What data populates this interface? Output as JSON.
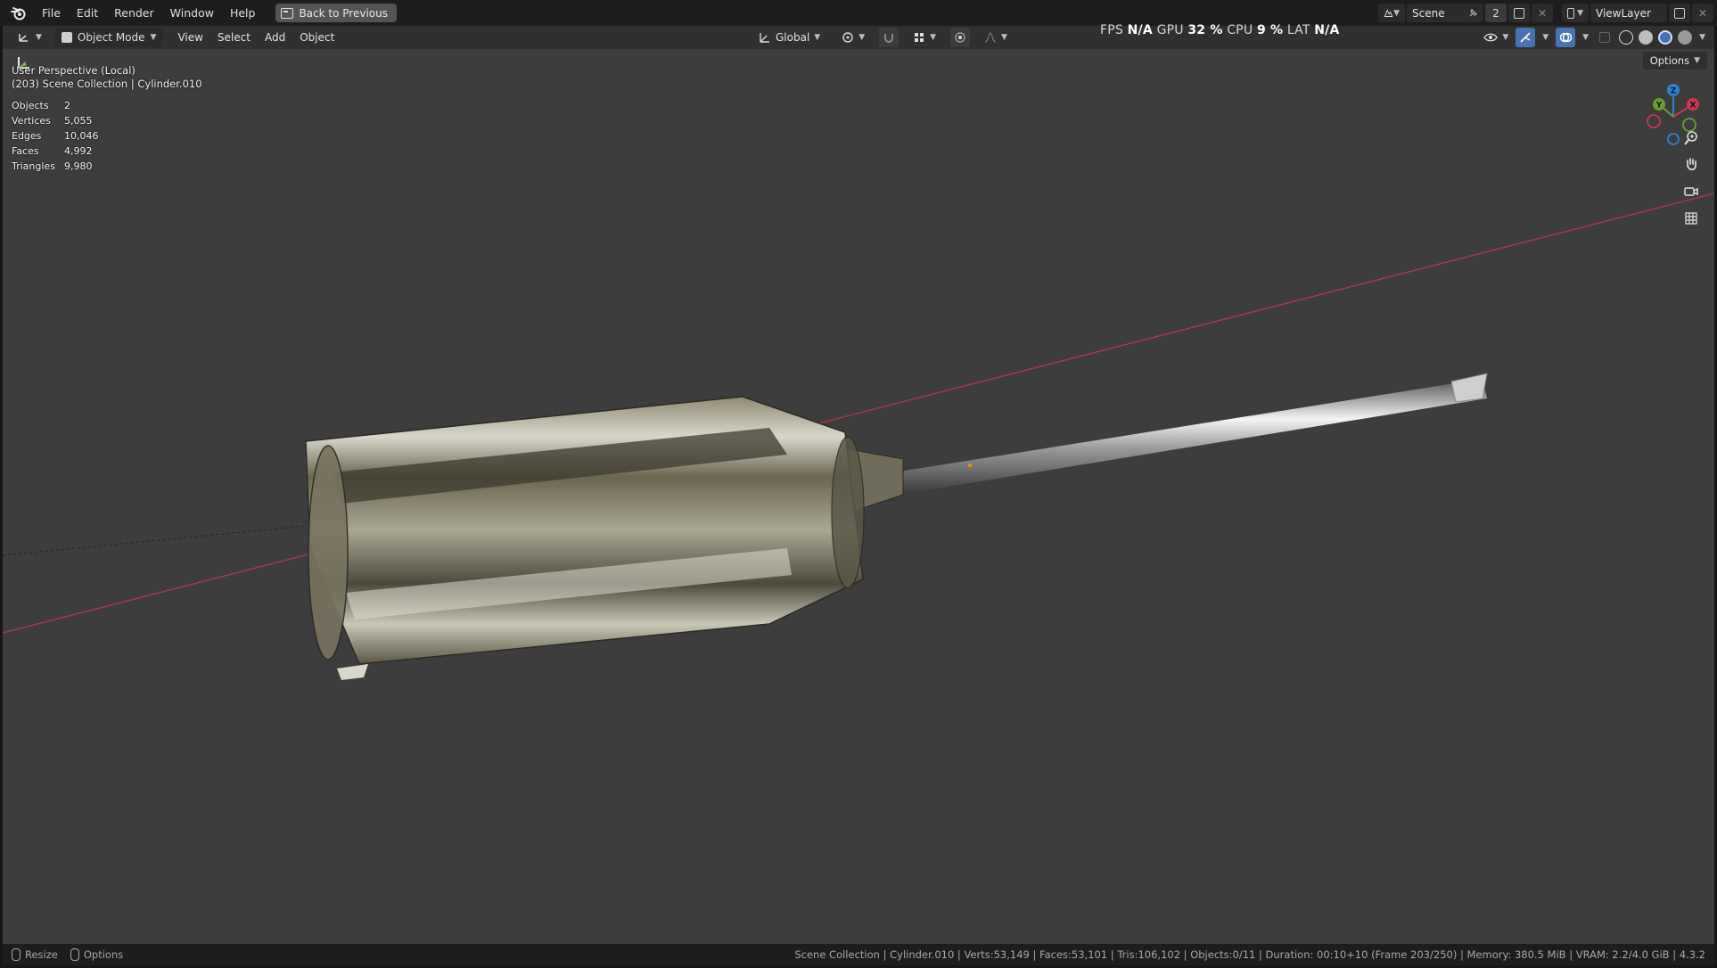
{
  "menu": {
    "items": [
      "File",
      "Edit",
      "Render",
      "Window",
      "Help"
    ],
    "back_label": "Back to Previous"
  },
  "top_right": {
    "scene_name": "Scene",
    "scene_users": "2",
    "view_layer": "ViewLayer"
  },
  "header": {
    "mode": "Object Mode",
    "menus": [
      "View",
      "Select",
      "Add",
      "Object"
    ],
    "transform_orientation": "Global"
  },
  "perf": {
    "fps_label": "FPS",
    "fps_value": "N/A",
    "gpu_label": "GPU",
    "gpu_value": "32 %",
    "cpu_label": "CPU",
    "cpu_value": "9 %",
    "lat_label": "LAT",
    "lat_value": "N/A"
  },
  "viewport": {
    "view_name": "User Perspective (Local)",
    "collection_line": "(203) Scene Collection | Cylinder.010",
    "options_label": "Options",
    "stats": [
      {
        "label": "Objects",
        "value": "2"
      },
      {
        "label": "Vertices",
        "value": "5,055"
      },
      {
        "label": "Edges",
        "value": "10,046"
      },
      {
        "label": "Faces",
        "value": "4,992"
      },
      {
        "label": "Triangles",
        "value": "9,980"
      }
    ],
    "gizmo": {
      "x": "X",
      "y": "Y",
      "z": "Z"
    }
  },
  "statusbar": {
    "resize_label": "Resize",
    "options_label": "Options",
    "info": "Scene Collection | Cylinder.010 | Verts:53,149 | Faces:53,101 | Tris:106,102 | Objects:0/11 | Duration: 00:10+10 (Frame 203/250) | Memory: 380.5 MiB | VRAM: 2.2/4.0 GiB | 4.3.2"
  },
  "colors": {
    "viewport_bg": "#3d3d3d",
    "x_axis": "#c8394f",
    "y_axis": "#6c9f2c",
    "z_axis": "#2e82d6",
    "accent": "#4772b3"
  },
  "icons": [
    "blender-logo-icon",
    "back-icon",
    "editor-type-icon",
    "object-mode-icon",
    "global-orientation-icon",
    "pivot-icon",
    "snap-icon",
    "proportional-icon",
    "visibility-icon",
    "gizmo-icon",
    "overlay-icon",
    "xray-icon",
    "wireframe-shading-icon",
    "solid-shading-icon",
    "material-shading-icon",
    "rendered-shading-icon",
    "zoom-icon",
    "pan-hand-icon",
    "camera-icon",
    "ortho-grid-icon",
    "transform-tool-icon",
    "mouse-icon"
  ]
}
